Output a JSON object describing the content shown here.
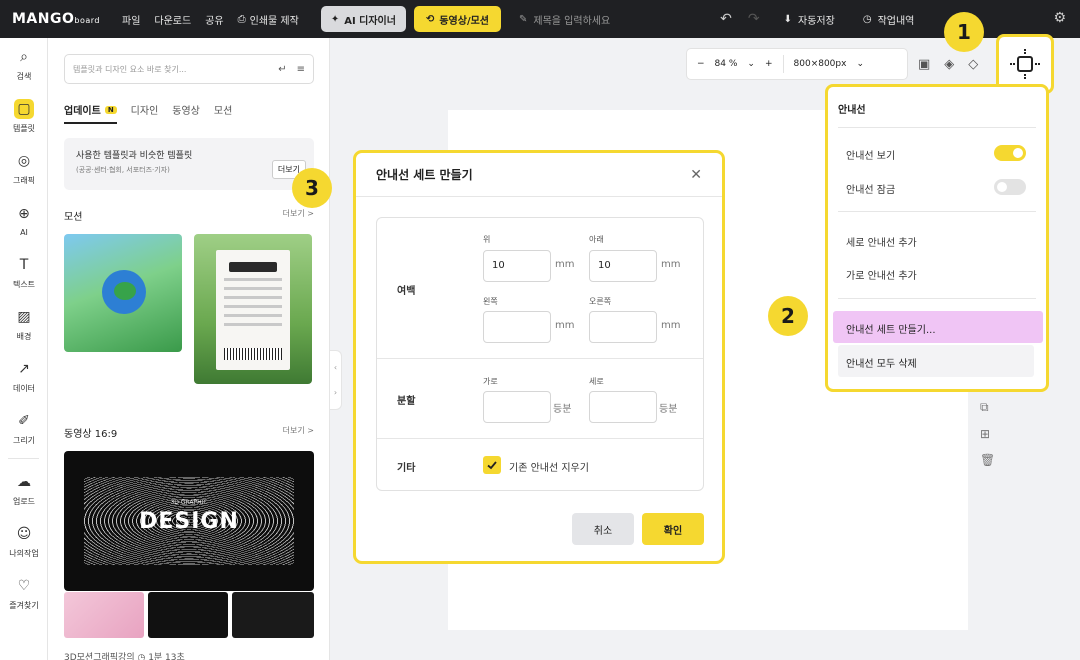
{
  "topbar": {
    "logo": "MANGO",
    "logo_sub": "board",
    "menu": [
      "파일",
      "다운로드",
      "공유"
    ],
    "print_label": "인쇄물 제작",
    "ai_label": "AI 디자이너",
    "video_label": "동영상/모션",
    "title_placeholder": "제목을 입력하세요",
    "autosave_label": "자동저장",
    "history_label": "작업내역"
  },
  "rail": [
    {
      "label": "검색",
      "icon": "search-icon"
    },
    {
      "label": "템플릿",
      "icon": "template-icon"
    },
    {
      "label": "그래픽",
      "icon": "graphic-icon"
    },
    {
      "label": "AI",
      "icon": "ai-icon"
    },
    {
      "label": "텍스트",
      "icon": "text-icon"
    },
    {
      "label": "배경",
      "icon": "background-icon"
    },
    {
      "label": "데이터",
      "icon": "chart-icon"
    },
    {
      "label": "그리기",
      "icon": "draw-icon"
    },
    {
      "label": "업로드",
      "icon": "upload-icon"
    },
    {
      "label": "나의작업",
      "icon": "my-work-icon"
    },
    {
      "label": "즐겨찾기",
      "icon": "favorite-icon"
    }
  ],
  "panel": {
    "search_placeholder": "템플릿과 디자인 요소 바로 찾기...",
    "tabs": [
      "업데이트",
      "디자인",
      "동영상",
      "모션"
    ],
    "new_badge": "N",
    "similar_title": "사용한 템플릿과 비슷한 템플릿",
    "similar_sub": "(공공·센터·협회, 서포터즈·기자)",
    "similar_more": "더보기",
    "motion_title": "모션",
    "motion_more": "더보기 >",
    "video_title": "동영상 16:9",
    "video_more": "더보기 >",
    "design_sub": "3D GRAPHIC",
    "design_word": "DESIGN",
    "bottom_caption": "3D모션그래픽강의  ◷ 1분 13초"
  },
  "canvas": {
    "zoom": "84 %",
    "size": "800×800px"
  },
  "guide_menu": {
    "title": "안내선",
    "show_label": "안내선 보기",
    "show_on": true,
    "lock_label": "안내선 잠금",
    "lock_on": false,
    "add_vertical": "세로 안내선 추가",
    "add_horizontal": "가로 안내선 추가",
    "make_set": "안내선 세트 만들기...",
    "delete_all": "안내선 모두 삭제"
  },
  "badges": [
    "1",
    "2",
    "3"
  ],
  "dialog": {
    "title": "안내선 세트 만들기",
    "margin_label": "여백",
    "top_label": "위",
    "bottom_label": "아래",
    "left_label": "왼쪽",
    "right_label": "오른쪽",
    "top_value": "10",
    "bottom_value": "10",
    "left_value": "",
    "right_value": "",
    "unit_mm": "mm",
    "split_label": "분할",
    "cols_label": "가로",
    "rows_label": "세로",
    "unit_split": "등분",
    "etc_label": "기타",
    "clear_label": "기존 안내선 지우기",
    "clear_checked": true,
    "cancel": "취소",
    "ok": "확인"
  },
  "colors": {
    "accent": "#f5d830",
    "highlight": "#f0c5f5",
    "topbar": "#1f2023"
  }
}
